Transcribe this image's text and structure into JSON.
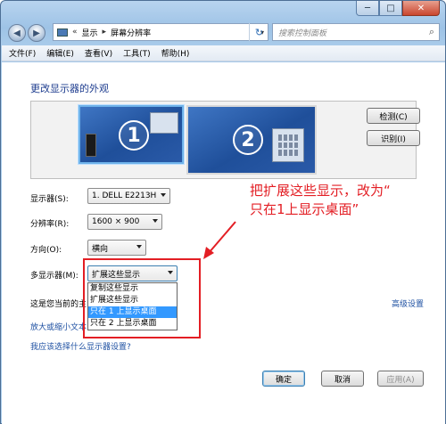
{
  "window": {
    "controls": [
      "─",
      "□",
      "✕"
    ]
  },
  "address": {
    "back_glyph": "◀",
    "forward_glyph": "▶",
    "prefix": "«",
    "crumb_1": "显示",
    "separator": "▸",
    "crumb_2": "屏幕分辨率",
    "dropdown_glyph": "▾",
    "refresh_glyph": "↻",
    "search_placeholder": "搜索控制面板",
    "search_glyph": "⌕"
  },
  "menu": {
    "items": [
      "文件(F)",
      "编辑(E)",
      "查看(V)",
      "工具(T)",
      "帮助(H)"
    ]
  },
  "main": {
    "heading": "更改显示器的外观",
    "monitor_1_number": "1",
    "monitor_2_number": "2",
    "detect_button": "检测(C)",
    "identify_button": "识别(I)"
  },
  "settings": {
    "display_label": "显示器(S):",
    "display_value": "1. DELL E2213H",
    "resolution_label": "分辨率(R):",
    "resolution_value": "1600 × 900",
    "orientation_label": "方向(O):",
    "orientation_value": "横向",
    "multi_label": "多显示器(M):",
    "multi_value": "扩展这些显示",
    "current_main_text": "这是您当前的主",
    "multi_options": [
      "复制这些显示",
      "扩展这些显示",
      "只在 1 上显示桌面",
      "只在 2 上显示桌面"
    ],
    "selected_option_index": 2
  },
  "links": {
    "advanced": "高级设置",
    "enlarge_text": "放大或缩小文本",
    "which_settings": "我应该选择什么显示器设置?"
  },
  "annotation": {
    "line_1": "把扩展这些显示，改为“",
    "line_2": "只在1上显示桌面”"
  },
  "footer": {
    "ok": "确定",
    "cancel": "取消",
    "apply": "应用(A)"
  },
  "colors": {
    "heading": "#1e3d8f",
    "link": "#1e50a2",
    "annotation": "#e31e24",
    "selected_option": "#3399ff"
  }
}
